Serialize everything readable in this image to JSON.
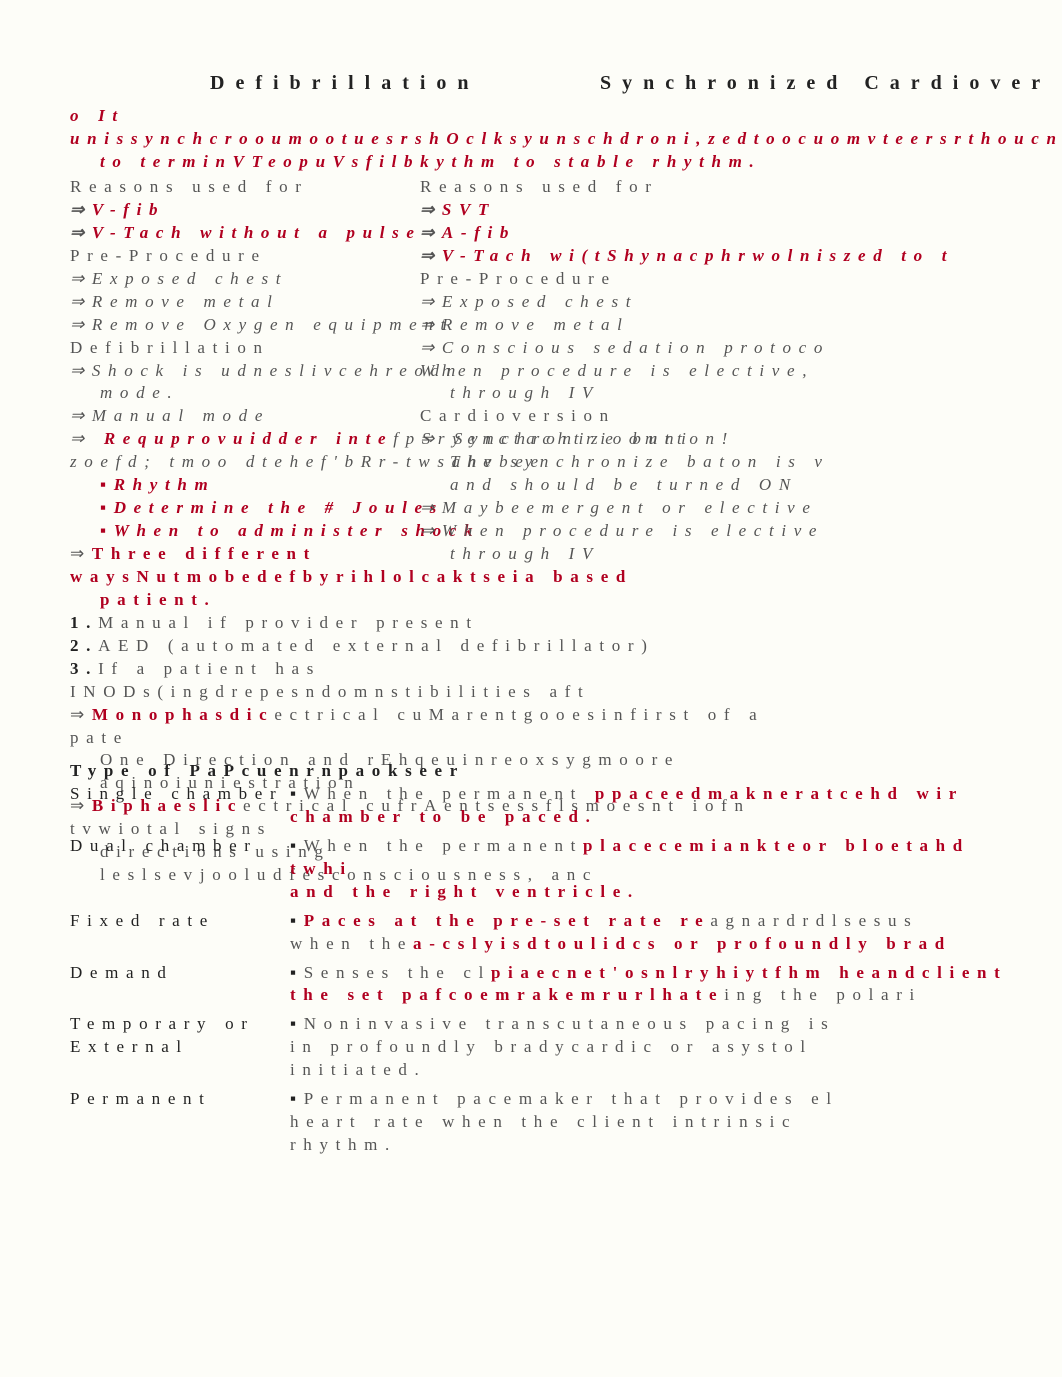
{
  "headers": {
    "left": "Defibrillation",
    "right": "Synchronized Cardiover"
  },
  "intro": {
    "left": "It unissynchcrooumootuesrshOclksyunschdroni,zedtoocuomvteersrthoucnkd",
    "left2": "to terminVTeopuVsfilbkythm to stable rhythm."
  },
  "labels": {
    "usedfor": "Reasons used for",
    "preproc": "Pre-Procedure",
    "defib": "Defibrillation",
    "cardio": "Cardioversion"
  },
  "usedforA": {
    "i1": "V-fib",
    "i2": "V-Tach without a pulse"
  },
  "usedforB": {
    "i1": "SVT",
    "i2": "A-fib",
    "i3": "V-Tach wi(tShynacphrwolniszed to t"
  },
  "preA": {
    "i1": "Exposed chest",
    "i2": "Remove metal",
    "i3": "Remove Oxygen equipment"
  },
  "preB": {
    "i1": "Exposed chest",
    "i2": "Remove metal",
    "i3": "Conscious sedation protoco"
  },
  "defibA": {
    "i1": "Shock is udneslivcehreodn",
    "i1m": "mode.",
    "i2": "Manual mode",
    "i3": "Requprovuidder intefpSryenctachtrioomni zoefd; tmoo dtehef'bRr-twsahvbee",
    "b1": "Rhythm",
    "b2": "Determine the # Joules",
    "b3": "When to administer shock"
  },
  "cardioB": {
    "i1": "When procedure is elective,",
    "i1m": "through IV",
    "i2": "Synchronize button!",
    "i2b": "The synchronize baton is v",
    "i2c": "and should be turned ON",
    "i3": "Maybeemergent or elective",
    "i4": "When procedure is elective",
    "i4b": "through IV"
  },
  "three": {
    "line": "Three different waysNutmobedefbyrihlolcaktseia based",
    "line2": "patient.",
    "n1": "Manual if provider present",
    "n2": "AED (automated external defibrillator)",
    "n3": "If a patient has INODs(ingdrepesndomnstibilities aft"
  },
  "mono": {
    "line": "Monophasdicectrical cuMarentgooesinfirst of a pate",
    "line2": "One Direction and rEhqeuinreoxsygmoore aqinoiuniestration"
  },
  "biph": {
    "line": "Biphaeslicectrical cufrAentsessflsmoesnt iofn tvwiotal signs",
    "line2": "directions using leslsevjooludfesconsciousness, anc"
  },
  "pacemaker": {
    "heading": "Type of PaPcuenrnpaokseer",
    "rows": [
      {
        "lab": "Single chamber",
        "desc": "When the permanent ppaceedmakneratcehd wir",
        "desc2": "chamber to be paced."
      },
      {
        "lab": "Dual chamber",
        "desc": "When the permanentplacecemiankteor bloetahd twhi",
        "desc2": "and the right ventricle."
      },
      {
        "lab": "Fixed rate",
        "desc": "Paces at the pre-set rate reagnardrdlsesus",
        "desc2": "when thea-cslyisdtoulidcs or profoundly brad"
      },
      {
        "lab": "Demand",
        "desc": "Senses the clpiaecnet'osnlryhiytfhm heandclient",
        "desc2": "the set pafcoemrakemrurlhateing the polari"
      },
      {
        "lab": "Temporary or External",
        "desc": "Noninvasive transcutaneous pacing is",
        "desc2": "in profoundly bradycardic or asystol",
        "desc3": "initiated."
      },
      {
        "lab": "Permanent",
        "desc": "Permanent pacemaker that provides el",
        "desc2": "heart rate when the client intrinsic",
        "desc3": "rhythm."
      }
    ]
  }
}
